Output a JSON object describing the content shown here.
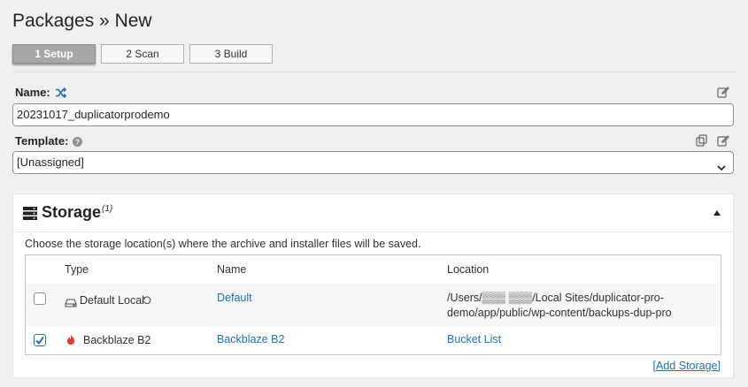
{
  "header": {
    "title": "Packages » New"
  },
  "steps": [
    {
      "label": "1 Setup",
      "active": true
    },
    {
      "label": "2 Scan",
      "active": false
    },
    {
      "label": "3 Build",
      "active": false
    }
  ],
  "name_field": {
    "label": "Name:",
    "value": "20231017_duplicatorprodemo"
  },
  "template_field": {
    "label": "Template:",
    "value": "[Unassigned]"
  },
  "storage": {
    "title": "Storage",
    "count": "(1)",
    "description": "Choose the storage location(s) where the archive and installer files will be saved.",
    "columns": {
      "type": "Type",
      "name": "Name",
      "location": "Location"
    },
    "rows": [
      {
        "checked": false,
        "type": "Default Local",
        "type_icon": "hard-drive-icon",
        "name": "Default",
        "location_line1": "/Users/▒▒▒ ▒▒▒/Local Sites/duplicator-pro-",
        "location_line2": "demo/app/public/wp-content/backups-dup-pro"
      },
      {
        "checked": true,
        "type": "Backblaze B2",
        "type_icon": "flame-icon",
        "name": "Backblaze B2",
        "location_line1": "Bucket List",
        "location_line2": ""
      }
    ],
    "add_link": "[Add Storage]"
  },
  "colors": {
    "accent": "#2271b1",
    "flame": "#d9382d"
  }
}
